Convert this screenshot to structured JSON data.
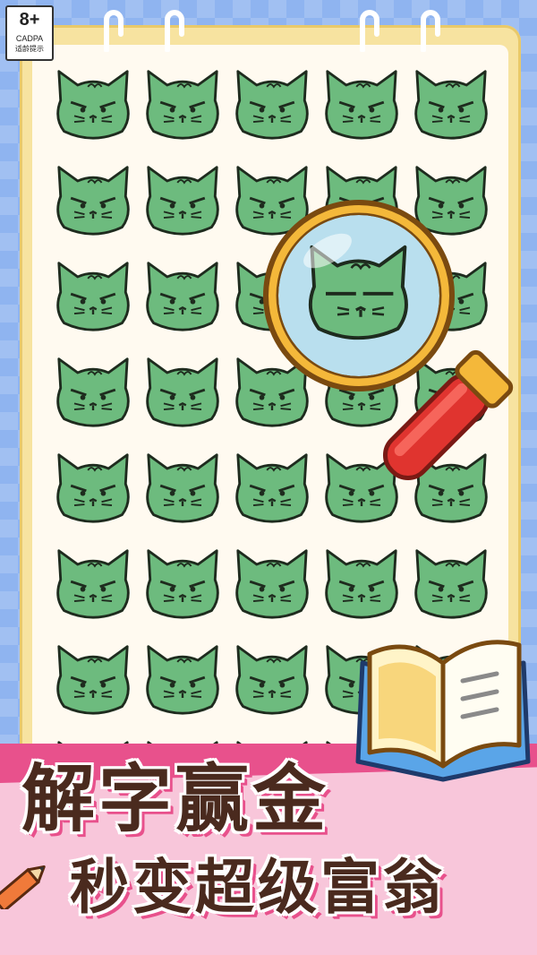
{
  "age_rating": {
    "age": "8+",
    "org": "CADPA",
    "hint": "适龄提示"
  },
  "puzzle": {
    "rows": 8,
    "cols": 5,
    "cat_color": "#6dbb7e",
    "odd_cat": "cat-with-straight-brows-under-magnifier"
  },
  "title": {
    "line1": "解字赢金",
    "line2": "秒变超级富翁"
  },
  "colors": {
    "background": "#8fb4f0",
    "notebook": "#f7e3a0",
    "banner_pink": "#f8c6da",
    "accent_pink": "#e8518c",
    "title_brown": "#4a2a1e",
    "magnifier_frame": "#f4b83a",
    "magnifier_handle": "#e0342f"
  },
  "icons": [
    "magnifier-icon",
    "book-icon",
    "pencil-icon"
  ]
}
